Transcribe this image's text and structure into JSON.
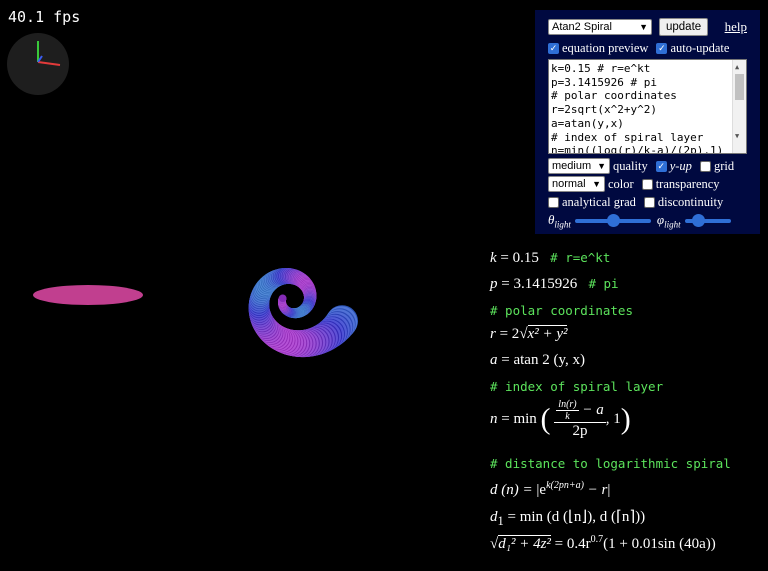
{
  "fps": "40.1 fps",
  "controls": {
    "preset_selected": "Atan2 Spiral",
    "update_label": "update",
    "help_label": "help",
    "equation_preview": {
      "label": "equation preview",
      "checked": true
    },
    "auto_update": {
      "label": "auto-update",
      "checked": true
    },
    "code_lines": [
      "k=0.15 # r=e^kt",
      "p=3.1415926 # pi",
      "# polar coordinates",
      "r=2sqrt(x^2+y^2)",
      "a=atan(y,x)",
      "# index of spiral layer",
      "n=min((log(r)/k-a)/(2p),1)"
    ],
    "quality_selected": "medium",
    "quality_label": "quality",
    "y_up": {
      "label": "y-up",
      "checked": true
    },
    "grid": {
      "label": "grid",
      "checked": false
    },
    "color_selected": "normal",
    "color_label": "color",
    "transparency": {
      "label": "transparency",
      "checked": false
    },
    "analytical_grad": {
      "label": "analytical grad",
      "checked": false
    },
    "discontinuity": {
      "label": "discontinuity",
      "checked": false
    },
    "theta_light_label": "θ",
    "theta_light_sub": "light",
    "phi_light_label": "φ",
    "phi_light_sub": "light",
    "theta_light_value": 0.5,
    "phi_light_value": 0.3
  },
  "equations": {
    "k_lhs": "k",
    "k_rhs": "= 0.15",
    "k_comment": "# r=e^kt",
    "p_lhs": "p",
    "p_rhs": "= 3.1415926",
    "p_comment": "# pi",
    "polar_comment": "# polar coordinates",
    "r_lhs": "r",
    "r_eq": "= 2",
    "r_rad": "x² + y²",
    "a_lhs": "a",
    "a_rhs": "= atan 2 (y, x)",
    "index_comment": "# index of spiral layer",
    "n_lhs": "n",
    "n_eq": "= min",
    "n_num_top": "ln(r)",
    "n_num_bot": "k",
    "n_minus_a": "− a",
    "n_den": "2p",
    "n_tail": ", 1",
    "dist_comment": "# distance to logarithmic spiral",
    "d_lhs": "d (n) =",
    "d_rhs": "e",
    "d_exp": "k(2pn+a)",
    "d_tail": "− r",
    "d1_lhs": "d",
    "d1_sub": "1",
    "d1_rhs": "= min (d (⌊n⌋), d (⌈n⌉))",
    "final_rad": "d₁² + 4z²",
    "final_rhs": "= 0.4r",
    "final_exp": "0.7",
    "final_tail": "(1 + 0.01sin (40a))"
  },
  "colors": {
    "panel_bg": "#000940",
    "comment": "#5ce35c",
    "checkbox": "#2f6fd6"
  }
}
